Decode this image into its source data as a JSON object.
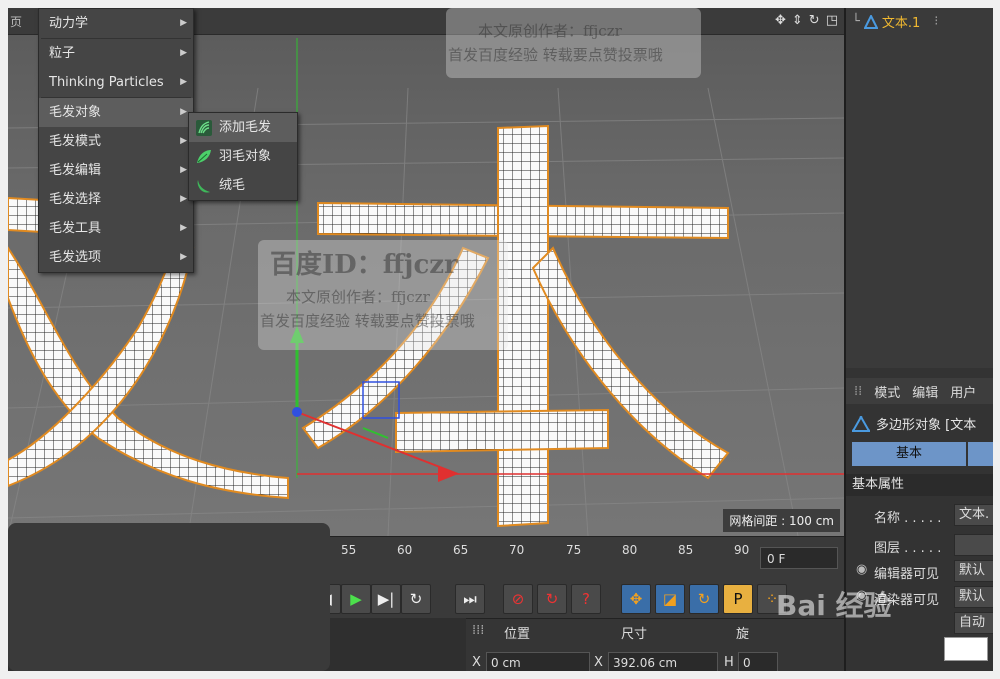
{
  "viewport": {
    "left_label": "页",
    "mode_label": "P",
    "grid_spacing": "网格间距 : 100 cm",
    "nav_icons": [
      "move-icon",
      "scale-icon",
      "rotate-icon",
      "maximize-icon"
    ]
  },
  "main_menu": {
    "items": [
      {
        "label": "动力学"
      },
      {
        "label": "粒子"
      },
      {
        "label": "Thinking Particles"
      },
      {
        "label": "毛发对象",
        "active": true
      },
      {
        "label": "毛发模式"
      },
      {
        "label": "毛发编辑"
      },
      {
        "label": "毛发选择"
      },
      {
        "label": "毛发工具"
      },
      {
        "label": "毛发选项"
      }
    ]
  },
  "submenu": {
    "items": [
      {
        "label": "添加毛发",
        "icon": "hair-icon",
        "active": true
      },
      {
        "label": "羽毛对象",
        "icon": "feather-icon"
      },
      {
        "label": "绒毛",
        "icon": "fur-icon"
      }
    ]
  },
  "watermark": {
    "author_top": "本文原创作者：ffjczr",
    "publish_top": "首发百度经验  转载要点赞投票哦",
    "baidu_id": "百度ID：ffjczr",
    "author_mid": "本文原创作者：ffjczr",
    "publish_mid": "首发百度经验  转载要点赞投票哦"
  },
  "timeline": {
    "ticks": [
      "55",
      "60",
      "65",
      "70",
      "75",
      "80",
      "85",
      "90"
    ],
    "current_frame": "0 F"
  },
  "coordinates": {
    "position_label": "位置",
    "size_label": "尺寸",
    "rotation_label": "旋",
    "x_position": "0 cm",
    "x_size": "392.06 cm",
    "h_rotation": "0",
    "x_axis": "X",
    "h_axis": "H"
  },
  "object_manager": {
    "object_name": "文本.1"
  },
  "attributes": {
    "tabs": [
      "模式",
      "编辑",
      "用户"
    ],
    "title": "多边形对象 [文本",
    "basic_tab": "基本",
    "section": "基本属性",
    "rows": [
      {
        "label": "名称 . . . . .",
        "value": "文本."
      },
      {
        "label": "图层 . . . . .",
        "value": ""
      },
      {
        "label": "编辑器可见",
        "value": "默认"
      },
      {
        "label": "渲染器可见",
        "value": "默认"
      },
      {
        "label": "",
        "value": "自动"
      }
    ]
  },
  "baidu_logo": "Bai 经验",
  "colors": {
    "accent": "#6d95c8",
    "object_name": "#f0b830",
    "x_axis": "#e03030",
    "y_axis": "#30c030",
    "z_axis": "#3050e0",
    "selection_outline": "#e08a20"
  }
}
